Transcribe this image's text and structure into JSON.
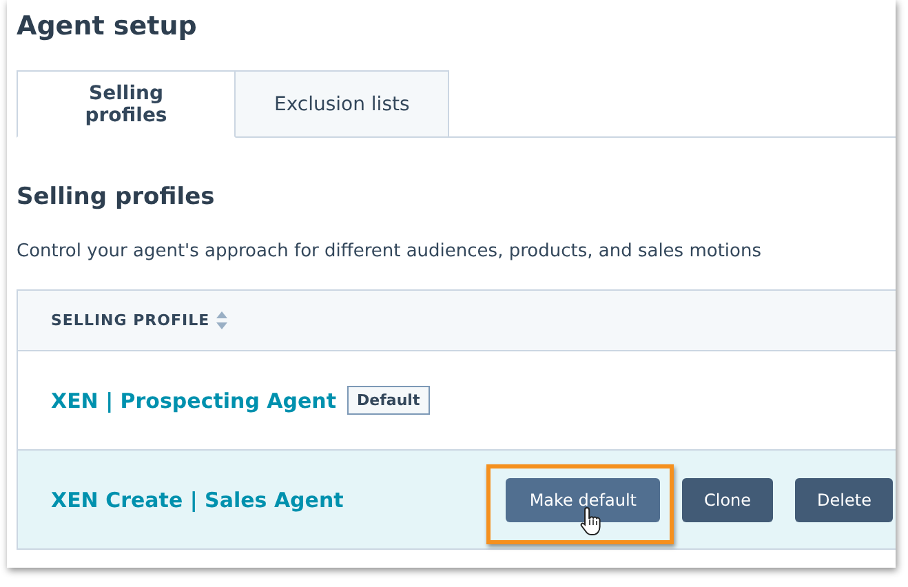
{
  "title": "Agent setup",
  "tabs": [
    {
      "label": "Selling profiles",
      "selected": true
    },
    {
      "label": "Exclusion lists",
      "selected": false
    }
  ],
  "section": {
    "title": "Selling profiles",
    "description": "Control your agent's approach for different audiences, products, and sales motions"
  },
  "table": {
    "column": "SELLING PROFILE",
    "rows": [
      {
        "name": "XEN | Prospecting Agent",
        "badge": "Default",
        "highlighted": false,
        "buttons": []
      },
      {
        "name": "XEN Create | Sales Agent",
        "highlighted": true,
        "buttons": [
          {
            "label": "Make default",
            "annotated": true
          },
          {
            "label": "Clone",
            "annotated": false
          },
          {
            "label": "Delete",
            "annotated": false
          }
        ]
      }
    ]
  }
}
